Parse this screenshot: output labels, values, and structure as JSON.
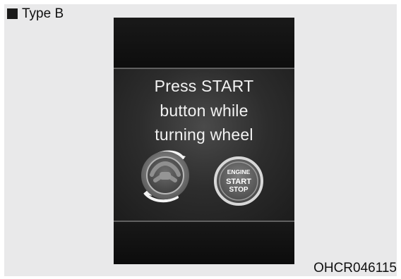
{
  "header": {
    "type_label": "Type B"
  },
  "display": {
    "message_lines": [
      "Press START",
      "button while",
      "turning wheel"
    ],
    "engine_button_lines": [
      "ENGINE",
      "START",
      "STOP"
    ]
  },
  "footer": {
    "figure_code": "OHCR046115"
  }
}
